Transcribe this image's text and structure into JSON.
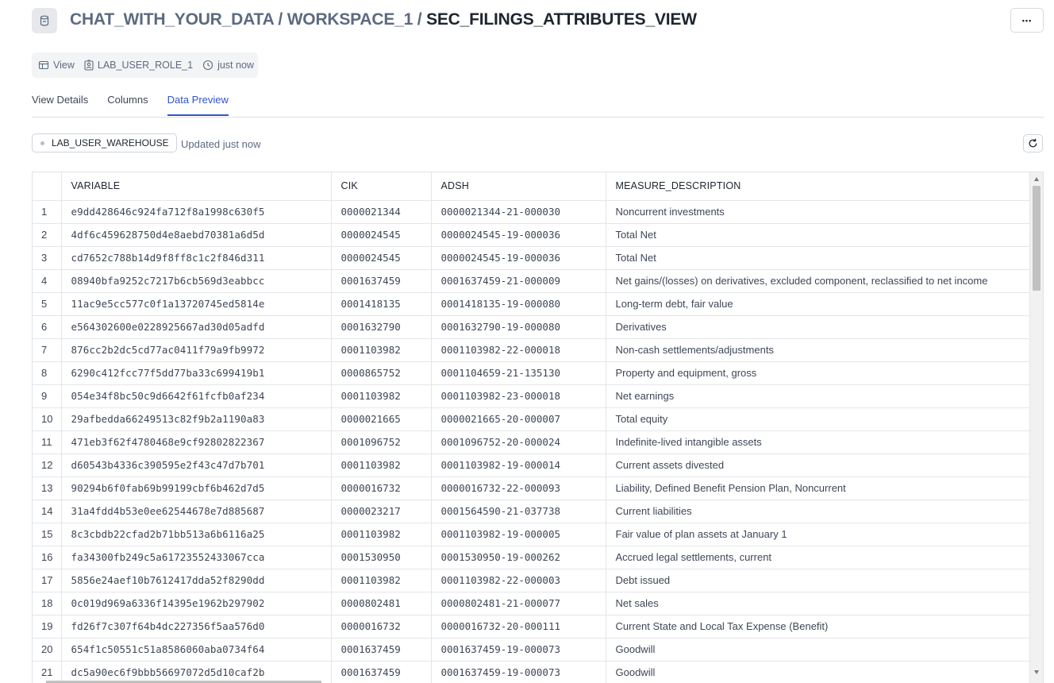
{
  "header": {
    "breadcrumb": [
      "CHAT_WITH_YOUR_DATA",
      "WORKSPACE_1"
    ],
    "separator": "/",
    "object_name": "SEC_FILINGS_ATTRIBUTES_VIEW",
    "more_label": "•••"
  },
  "meta": {
    "type_label": "View",
    "owner_label": "LAB_USER_ROLE_1",
    "time_label": "just now"
  },
  "tabs": [
    {
      "label": "View Details",
      "active": false
    },
    {
      "label": "Columns",
      "active": false
    },
    {
      "label": "Data Preview",
      "active": true
    }
  ],
  "preview": {
    "warehouse": "LAB_USER_WAREHOUSE",
    "updated": "Updated just now"
  },
  "table": {
    "columns": [
      "",
      "VARIABLE",
      "CIK",
      "ADSH",
      "MEASURE_DESCRIPTION"
    ],
    "rows": [
      [
        "1",
        "e9dd428646c924fa712f8a1998c630f5",
        "0000021344",
        "0000021344-21-000030",
        "Noncurrent investments"
      ],
      [
        "2",
        "4df6c459628750d4e8aebd70381a6d5d",
        "0000024545",
        "0000024545-19-000036",
        "Total Net"
      ],
      [
        "3",
        "cd7652c788b14d9f8ff8c1c2f846d311",
        "0000024545",
        "0000024545-19-000036",
        "Total Net"
      ],
      [
        "4",
        "08940bfa9252c7217b6cb569d3eabbcc",
        "0001637459",
        "0001637459-21-000009",
        "Net gains/(losses) on derivatives, excluded component, reclassified to net income"
      ],
      [
        "5",
        "11ac9e5cc577c0f1a13720745ed5814e",
        "0001418135",
        "0001418135-19-000080",
        "Long-term debt, fair value"
      ],
      [
        "6",
        "e564302600e0228925667ad30d05adfd",
        "0001632790",
        "0001632790-19-000080",
        "Derivatives"
      ],
      [
        "7",
        "876cc2b2dc5cd77ac0411f79a9fb9972",
        "0001103982",
        "0001103982-22-000018",
        "Non-cash settlements/adjustments"
      ],
      [
        "8",
        "6290c412fcc77f5dd77ba33c699419b1",
        "0000865752",
        "0001104659-21-135130",
        "Property and equipment, gross"
      ],
      [
        "9",
        "054e34f8bc50c9d6642f61fcfb0af234",
        "0001103982",
        "0001103982-23-000018",
        "Net earnings"
      ],
      [
        "10",
        "29afbedda66249513c82f9b2a1190a83",
        "0000021665",
        "0000021665-20-000007",
        "Total equity"
      ],
      [
        "11",
        "471eb3f62f4780468e9cf92802822367",
        "0001096752",
        "0001096752-20-000024",
        "Indefinite-lived intangible assets"
      ],
      [
        "12",
        "d60543b4336c390595e2f43c47d7b701",
        "0001103982",
        "0001103982-19-000014",
        "Current assets divested"
      ],
      [
        "13",
        "90294b6f0fab69b99199cbf6b462d7d5",
        "0000016732",
        "0000016732-22-000093",
        "Liability, Defined Benefit Pension Plan, Noncurrent"
      ],
      [
        "14",
        "31a4fdd4b53e0ee62544678e7d885687",
        "0000023217",
        "0001564590-21-037738",
        "Current liabilities"
      ],
      [
        "15",
        "8c3cbdb22cfad2b71bb513a6b6116a25",
        "0001103982",
        "0001103982-19-000005",
        "Fair value of plan assets at January 1"
      ],
      [
        "16",
        "fa34300fb249c5a61723552433067cca",
        "0001530950",
        "0001530950-19-000262",
        "Accrued legal settlements, current"
      ],
      [
        "17",
        "5856e24aef10b7612417dda52f8290dd",
        "0001103982",
        "0001103982-22-000003",
        "Debt issued"
      ],
      [
        "18",
        "0c019d969a6336f14395e1962b297902",
        "0000802481",
        "0000802481-21-000077",
        "Net sales"
      ],
      [
        "19",
        "fd26f7c307f64b4dc227356f5aa576d0",
        "0000016732",
        "0000016732-20-000111",
        "Current State and Local Tax Expense (Benefit)"
      ],
      [
        "20",
        "654f1c50551c51a8586060aba0734f64",
        "0001637459",
        "0001637459-19-000073",
        "Goodwill"
      ],
      [
        "21",
        "dc5a90ec6f9bbb56697072d5d10caf2b",
        "0001637459",
        "0001637459-19-000073",
        "Goodwill"
      ]
    ]
  },
  "icons": {
    "object": "view-object-icon",
    "type": "view-icon",
    "owner": "role-icon",
    "time": "clock-icon",
    "refresh": "refresh-icon",
    "more": "ellipsis-icon"
  },
  "colors": {
    "accent": "#2f56c9",
    "text": "#1e252f",
    "muted": "#5d6a80"
  }
}
